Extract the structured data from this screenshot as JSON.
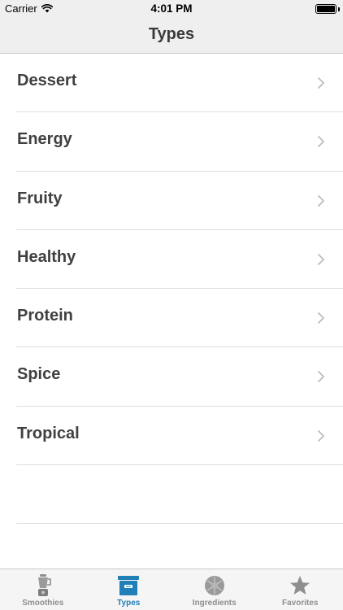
{
  "status_bar": {
    "carrier": "Carrier",
    "time": "4:01 PM",
    "battery_level": 1.0
  },
  "nav": {
    "title": "Types"
  },
  "list": {
    "items": [
      {
        "label": "Dessert"
      },
      {
        "label": "Energy"
      },
      {
        "label": "Fruity"
      },
      {
        "label": "Healthy"
      },
      {
        "label": "Protein"
      },
      {
        "label": "Spice"
      },
      {
        "label": "Tropical"
      }
    ]
  },
  "tab_bar": {
    "tabs": [
      {
        "label": "Smoothies",
        "icon": "blender-icon",
        "active": false
      },
      {
        "label": "Types",
        "icon": "file-box-icon",
        "active": true
      },
      {
        "label": "Ingredients",
        "icon": "fruit-icon",
        "active": false
      },
      {
        "label": "Favorites",
        "icon": "star-icon",
        "active": false
      }
    ],
    "active_color": "#1f7fb6",
    "inactive_color": "#8e8e8e"
  }
}
